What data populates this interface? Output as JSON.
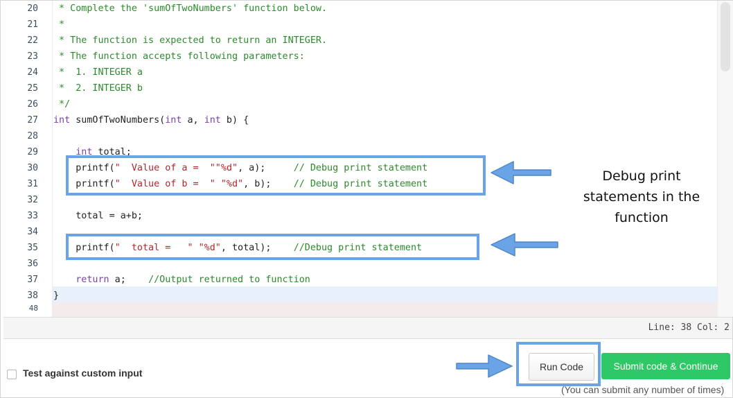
{
  "colors": {
    "comment": "#2b8a2b",
    "keyword": "#7a3fa8",
    "string": "#b3262a",
    "highlight_box": "#6aa3e6",
    "submit_bg": "#2ec866"
  },
  "editor": {
    "lines": [
      {
        "no": "20",
        "segments": [
          {
            "t": "cm",
            "text": " * Complete the 'sumOfTwoNumbers' function below."
          }
        ]
      },
      {
        "no": "21",
        "segments": [
          {
            "t": "cm",
            "text": " *"
          }
        ]
      },
      {
        "no": "22",
        "segments": [
          {
            "t": "cm",
            "text": " * The function is expected to return an INTEGER."
          }
        ]
      },
      {
        "no": "23",
        "segments": [
          {
            "t": "cm",
            "text": " * The function accepts following parameters:"
          }
        ]
      },
      {
        "no": "24",
        "segments": [
          {
            "t": "cm",
            "text": " *  1. INTEGER a"
          }
        ]
      },
      {
        "no": "25",
        "segments": [
          {
            "t": "cm",
            "text": " *  2. INTEGER b"
          }
        ]
      },
      {
        "no": "26",
        "segments": [
          {
            "t": "cm",
            "text": " */"
          }
        ]
      },
      {
        "no": "27",
        "segments": [
          {
            "t": "kw",
            "text": "int"
          },
          {
            "t": "pl",
            "text": " sumOfTwoNumbers("
          },
          {
            "t": "kw",
            "text": "int"
          },
          {
            "t": "pl",
            "text": " a, "
          },
          {
            "t": "kw",
            "text": "int"
          },
          {
            "t": "pl",
            "text": " b) {"
          }
        ]
      },
      {
        "no": "28",
        "segments": []
      },
      {
        "no": "29",
        "segments": [
          {
            "t": "pl",
            "text": "    "
          },
          {
            "t": "kw",
            "text": "int"
          },
          {
            "t": "pl",
            "text": " total;"
          }
        ]
      },
      {
        "no": "30",
        "segments": [
          {
            "t": "pl",
            "text": "    printf("
          },
          {
            "t": "str",
            "text": "\"  Value of a =  \"\"%d\""
          },
          {
            "t": "pl",
            "text": ", a);     "
          },
          {
            "t": "cm",
            "text": "// Debug print statement"
          }
        ]
      },
      {
        "no": "31",
        "segments": [
          {
            "t": "pl",
            "text": "    printf("
          },
          {
            "t": "str",
            "text": "\"  Value of b =  \" \"%d\""
          },
          {
            "t": "pl",
            "text": ", b);    "
          },
          {
            "t": "cm",
            "text": "// Debug print statement"
          }
        ]
      },
      {
        "no": "32",
        "segments": []
      },
      {
        "no": "33",
        "segments": [
          {
            "t": "pl",
            "text": "    total = a+b;"
          }
        ]
      },
      {
        "no": "34",
        "segments": []
      },
      {
        "no": "35",
        "segments": [
          {
            "t": "pl",
            "text": "    printf("
          },
          {
            "t": "str",
            "text": "\"  total =   \" \"%d\""
          },
          {
            "t": "pl",
            "text": ", total);    "
          },
          {
            "t": "cm",
            "text": "//Debug print statement"
          }
        ]
      },
      {
        "no": "36",
        "segments": []
      },
      {
        "no": "37",
        "segments": [
          {
            "t": "pl",
            "text": "    "
          },
          {
            "t": "kw",
            "text": "return"
          },
          {
            "t": "pl",
            "text": " a;    "
          },
          {
            "t": "cm",
            "text": "//Output returned to function"
          }
        ]
      },
      {
        "no": "38",
        "segments": [
          {
            "t": "pl",
            "text": "}"
          }
        ]
      },
      {
        "no": "48",
        "segments": []
      }
    ]
  },
  "status_bar": {
    "position": "Line: 38 Col: 2"
  },
  "annotation": {
    "text_lines": [
      "Debug print",
      "statements in the",
      "function"
    ]
  },
  "footer": {
    "custom_input_label": "Test against custom input",
    "run_code_label": "Run Code",
    "submit_label": "Submit code & Continue",
    "submit_note": "(You can submit any number of times)"
  }
}
